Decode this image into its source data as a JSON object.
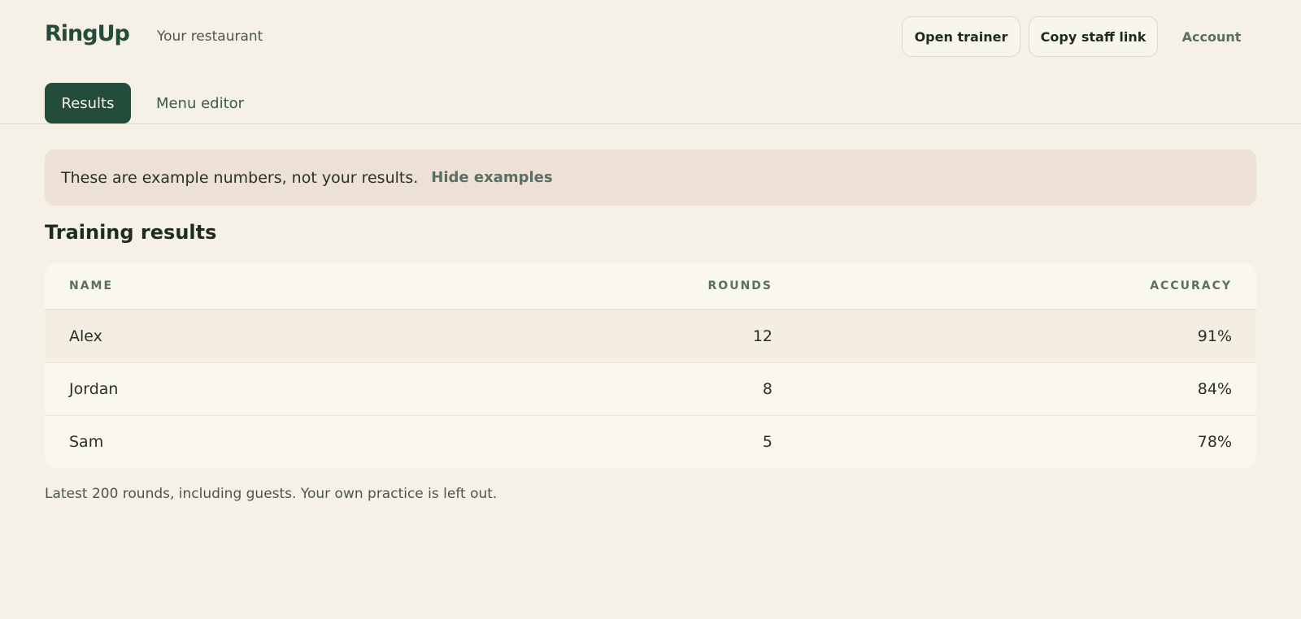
{
  "header": {
    "brand": "RingUp",
    "restaurant": "Your restaurant",
    "open_trainer": "Open trainer",
    "copy_staff_link": "Copy staff link",
    "account": "Account"
  },
  "tabs": [
    {
      "label": "Results",
      "active": true
    },
    {
      "label": "Menu editor",
      "active": false
    }
  ],
  "banner": {
    "text": "These are example numbers, not your results.",
    "link": "Hide examples"
  },
  "section_title": "Training results",
  "table": {
    "columns": [
      "NAME",
      "ROUNDS",
      "ACCURACY"
    ],
    "rows": [
      {
        "name": "Alex",
        "rounds": "12",
        "accuracy": "91%"
      },
      {
        "name": "Jordan",
        "rounds": "8",
        "accuracy": "84%"
      },
      {
        "name": "Sam",
        "rounds": "5",
        "accuracy": "78%"
      }
    ]
  },
  "footnote": "Latest 200 rounds, including guests. Your own practice is left out.",
  "colors": {
    "brand": "#244c3a",
    "background": "#f5f1e7",
    "banner": "#ede0d5"
  }
}
